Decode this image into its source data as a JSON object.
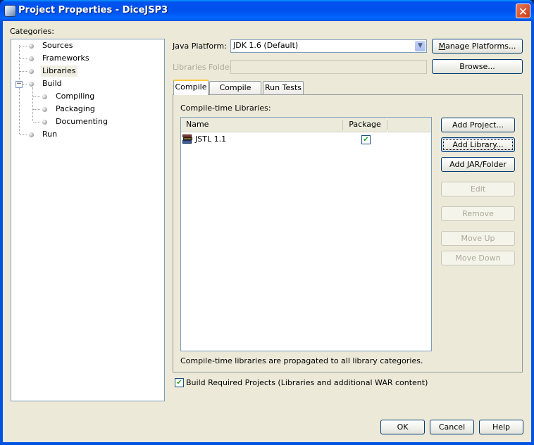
{
  "window": {
    "title": "Project Properties - DiceJSP3",
    "close_label": "✕"
  },
  "categories": {
    "label": "Categories:",
    "items": [
      {
        "label": "Sources",
        "level": 0,
        "selected": false
      },
      {
        "label": "Frameworks",
        "level": 0,
        "selected": false
      },
      {
        "label": "Libraries",
        "level": 0,
        "selected": true
      },
      {
        "label": "Build",
        "level": 0,
        "selected": false,
        "expanded": true
      },
      {
        "label": "Compiling",
        "level": 1,
        "selected": false
      },
      {
        "label": "Packaging",
        "level": 1,
        "selected": false
      },
      {
        "label": "Documenting",
        "level": 1,
        "selected": false
      },
      {
        "label": "Run",
        "level": 0,
        "selected": false
      }
    ],
    "expander_glyph": "−"
  },
  "platform": {
    "label_prefix": "J",
    "label_rest": "ava Platform:",
    "value": "JDK 1.6 (Default)",
    "arrow": "▼",
    "manage_prefix": "M",
    "manage_rest": "anage Platforms..."
  },
  "libraries_folder": {
    "label": "Libraries Folder:",
    "value": "",
    "browse": "Browse..."
  },
  "tabs": [
    {
      "label": "Compile",
      "active": true
    },
    {
      "label": "Compile Tests",
      "active": false
    },
    {
      "label": "Run Tests",
      "active": false
    }
  ],
  "compile": {
    "label": "Compile-time Libraries:",
    "columns": [
      "Name",
      "Package"
    ],
    "rows": [
      {
        "name": "JSTL 1.1",
        "package": true
      }
    ],
    "check_glyph": "✔",
    "note": "Compile-time libraries are propagated to all library categories."
  },
  "side_buttons": {
    "add_project": "Add Project...",
    "add_library": "Add Library...",
    "add_jar": "Add JAR/Folder",
    "edit": "Edit",
    "remove": "Remove",
    "move_up": "Move Up",
    "move_down": "Move Down"
  },
  "build_required": {
    "label": "Build Required Projects (Libraries and additional WAR content)",
    "checked": true
  },
  "footer": {
    "ok": "OK",
    "cancel": "Cancel",
    "help": "Help"
  }
}
